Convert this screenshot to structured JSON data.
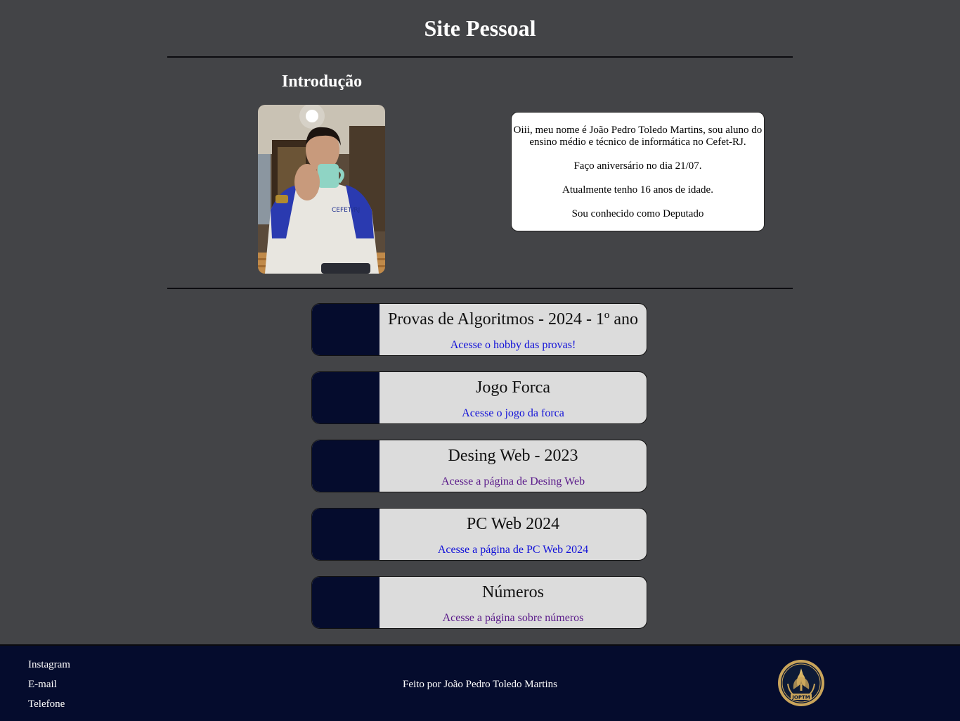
{
  "header": {
    "title": "Site Pessoal"
  },
  "intro": {
    "heading": "Introdução",
    "bio": [
      "Oiii, meu nome é João Pedro Toledo Martins, sou aluno do ensino médio e técnico de informática no Cefet-RJ.",
      "Faço aniversário no dia 21/07.",
      "Atualmente tenho 16 anos de idade.",
      "Sou conhecido como Deputado"
    ]
  },
  "cards": [
    {
      "title": "Provas de Algoritmos - 2024 - 1º ano",
      "link": "Acesse o hobby das provas!",
      "link_color": "#1010d8"
    },
    {
      "title": "Jogo Forca",
      "link": "Acesse o jogo da forca",
      "link_color": "#1010d8"
    },
    {
      "title": "Desing Web - 2023",
      "link": "Acesse a página de Desing Web",
      "link_color": "#5a1a8a"
    },
    {
      "title": "PC Web 2024",
      "link": "Acesse a página de PC Web 2024",
      "link_color": "#1010d8"
    },
    {
      "title": "Números",
      "link": "Acesse a página sobre números",
      "link_color": "#5a1a8a"
    }
  ],
  "footer": {
    "links": [
      "Instagram",
      "E-mail",
      "Telefone"
    ],
    "credit": "Feito por João Pedro Toledo Martins",
    "logo_text": "JOPTM"
  },
  "colors": {
    "background": "#434447",
    "card_strip": "#050c2d",
    "card_body": "#dcdcdc",
    "footer": "#050c2d"
  }
}
